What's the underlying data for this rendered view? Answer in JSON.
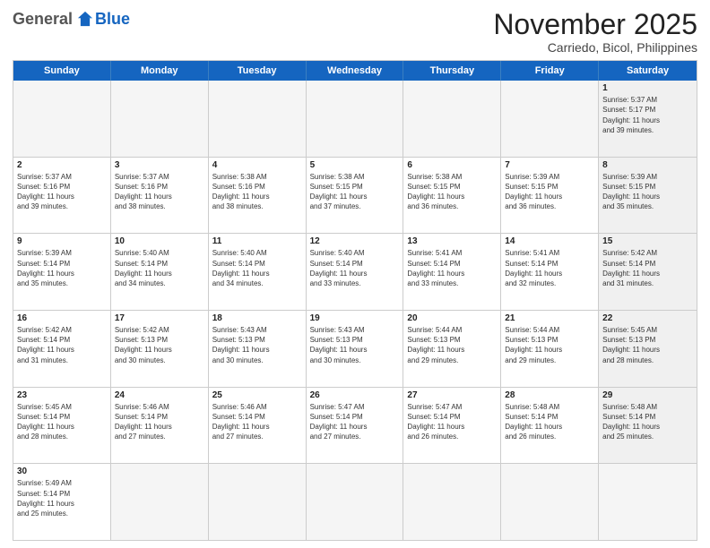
{
  "logo": {
    "general": "General",
    "blue": "Blue"
  },
  "title": "November 2025",
  "location": "Carriedo, Bicol, Philippines",
  "header_days": [
    "Sunday",
    "Monday",
    "Tuesday",
    "Wednesday",
    "Thursday",
    "Friday",
    "Saturday"
  ],
  "weeks": [
    [
      {
        "day": "",
        "text": "",
        "empty": true
      },
      {
        "day": "",
        "text": "",
        "empty": true
      },
      {
        "day": "",
        "text": "",
        "empty": true
      },
      {
        "day": "",
        "text": "",
        "empty": true
      },
      {
        "day": "",
        "text": "",
        "empty": true
      },
      {
        "day": "",
        "text": "",
        "empty": true
      },
      {
        "day": "1",
        "text": "Sunrise: 5:37 AM\nSunset: 5:17 PM\nDaylight: 11 hours\nand 39 minutes.",
        "shaded": true
      }
    ],
    [
      {
        "day": "2",
        "text": "Sunrise: 5:37 AM\nSunset: 5:16 PM\nDaylight: 11 hours\nand 39 minutes.",
        "shaded": false
      },
      {
        "day": "3",
        "text": "Sunrise: 5:37 AM\nSunset: 5:16 PM\nDaylight: 11 hours\nand 38 minutes.",
        "shaded": false
      },
      {
        "day": "4",
        "text": "Sunrise: 5:38 AM\nSunset: 5:16 PM\nDaylight: 11 hours\nand 38 minutes.",
        "shaded": false
      },
      {
        "day": "5",
        "text": "Sunrise: 5:38 AM\nSunset: 5:15 PM\nDaylight: 11 hours\nand 37 minutes.",
        "shaded": false
      },
      {
        "day": "6",
        "text": "Sunrise: 5:38 AM\nSunset: 5:15 PM\nDaylight: 11 hours\nand 36 minutes.",
        "shaded": false
      },
      {
        "day": "7",
        "text": "Sunrise: 5:39 AM\nSunset: 5:15 PM\nDaylight: 11 hours\nand 36 minutes.",
        "shaded": false
      },
      {
        "day": "8",
        "text": "Sunrise: 5:39 AM\nSunset: 5:15 PM\nDaylight: 11 hours\nand 35 minutes.",
        "shaded": true
      }
    ],
    [
      {
        "day": "9",
        "text": "Sunrise: 5:39 AM\nSunset: 5:14 PM\nDaylight: 11 hours\nand 35 minutes.",
        "shaded": false
      },
      {
        "day": "10",
        "text": "Sunrise: 5:40 AM\nSunset: 5:14 PM\nDaylight: 11 hours\nand 34 minutes.",
        "shaded": false
      },
      {
        "day": "11",
        "text": "Sunrise: 5:40 AM\nSunset: 5:14 PM\nDaylight: 11 hours\nand 34 minutes.",
        "shaded": false
      },
      {
        "day": "12",
        "text": "Sunrise: 5:40 AM\nSunset: 5:14 PM\nDaylight: 11 hours\nand 33 minutes.",
        "shaded": false
      },
      {
        "day": "13",
        "text": "Sunrise: 5:41 AM\nSunset: 5:14 PM\nDaylight: 11 hours\nand 33 minutes.",
        "shaded": false
      },
      {
        "day": "14",
        "text": "Sunrise: 5:41 AM\nSunset: 5:14 PM\nDaylight: 11 hours\nand 32 minutes.",
        "shaded": false
      },
      {
        "day": "15",
        "text": "Sunrise: 5:42 AM\nSunset: 5:14 PM\nDaylight: 11 hours\nand 31 minutes.",
        "shaded": true
      }
    ],
    [
      {
        "day": "16",
        "text": "Sunrise: 5:42 AM\nSunset: 5:14 PM\nDaylight: 11 hours\nand 31 minutes.",
        "shaded": false
      },
      {
        "day": "17",
        "text": "Sunrise: 5:42 AM\nSunset: 5:13 PM\nDaylight: 11 hours\nand 30 minutes.",
        "shaded": false
      },
      {
        "day": "18",
        "text": "Sunrise: 5:43 AM\nSunset: 5:13 PM\nDaylight: 11 hours\nand 30 minutes.",
        "shaded": false
      },
      {
        "day": "19",
        "text": "Sunrise: 5:43 AM\nSunset: 5:13 PM\nDaylight: 11 hours\nand 30 minutes.",
        "shaded": false
      },
      {
        "day": "20",
        "text": "Sunrise: 5:44 AM\nSunset: 5:13 PM\nDaylight: 11 hours\nand 29 minutes.",
        "shaded": false
      },
      {
        "day": "21",
        "text": "Sunrise: 5:44 AM\nSunset: 5:13 PM\nDaylight: 11 hours\nand 29 minutes.",
        "shaded": false
      },
      {
        "day": "22",
        "text": "Sunrise: 5:45 AM\nSunset: 5:13 PM\nDaylight: 11 hours\nand 28 minutes.",
        "shaded": true
      }
    ],
    [
      {
        "day": "23",
        "text": "Sunrise: 5:45 AM\nSunset: 5:14 PM\nDaylight: 11 hours\nand 28 minutes.",
        "shaded": false
      },
      {
        "day": "24",
        "text": "Sunrise: 5:46 AM\nSunset: 5:14 PM\nDaylight: 11 hours\nand 27 minutes.",
        "shaded": false
      },
      {
        "day": "25",
        "text": "Sunrise: 5:46 AM\nSunset: 5:14 PM\nDaylight: 11 hours\nand 27 minutes.",
        "shaded": false
      },
      {
        "day": "26",
        "text": "Sunrise: 5:47 AM\nSunset: 5:14 PM\nDaylight: 11 hours\nand 27 minutes.",
        "shaded": false
      },
      {
        "day": "27",
        "text": "Sunrise: 5:47 AM\nSunset: 5:14 PM\nDaylight: 11 hours\nand 26 minutes.",
        "shaded": false
      },
      {
        "day": "28",
        "text": "Sunrise: 5:48 AM\nSunset: 5:14 PM\nDaylight: 11 hours\nand 26 minutes.",
        "shaded": false
      },
      {
        "day": "29",
        "text": "Sunrise: 5:48 AM\nSunset: 5:14 PM\nDaylight: 11 hours\nand 25 minutes.",
        "shaded": true
      }
    ],
    [
      {
        "day": "30",
        "text": "Sunrise: 5:49 AM\nSunset: 5:14 PM\nDaylight: 11 hours\nand 25 minutes.",
        "shaded": false
      },
      {
        "day": "",
        "text": "",
        "empty": true
      },
      {
        "day": "",
        "text": "",
        "empty": true
      },
      {
        "day": "",
        "text": "",
        "empty": true
      },
      {
        "day": "",
        "text": "",
        "empty": true
      },
      {
        "day": "",
        "text": "",
        "empty": true
      },
      {
        "day": "",
        "text": "",
        "empty": true
      }
    ]
  ]
}
